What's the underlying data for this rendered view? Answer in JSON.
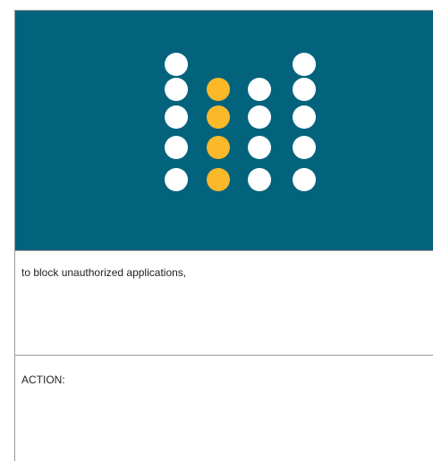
{
  "banner": {
    "background_color": "#03637d",
    "dot_color_default": "#ffffff",
    "dot_color_highlight": "#fbb829",
    "columns": [
      {
        "column": 1,
        "dots": 5,
        "highlighted": false
      },
      {
        "column": 2,
        "dots": 4,
        "highlighted": true
      },
      {
        "column": 3,
        "dots": 4,
        "highlighted": false
      },
      {
        "column": 4,
        "dots": 5,
        "highlighted": false
      }
    ]
  },
  "content": {
    "description": "to block unauthorized applications,",
    "action_label": "ACTION:"
  }
}
